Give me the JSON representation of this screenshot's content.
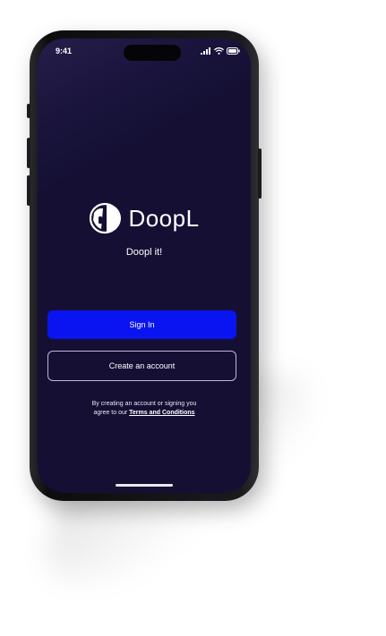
{
  "status_bar": {
    "time": "9:41",
    "icons": [
      "signal-icon",
      "wifi-icon",
      "battery-icon"
    ]
  },
  "brand": {
    "name": "DoopL",
    "tagline": "Doopl it!",
    "logo_icon": "doopl-logo-icon"
  },
  "buttons": {
    "sign_in": "Sign In",
    "create_account": "Create an account"
  },
  "legal": {
    "text_line1": "By creating an account or signing you",
    "text_line2_prefix": "agree to our",
    "link": "Terms and Conditions"
  },
  "colors": {
    "screen_bg": "#140f33",
    "primary_button": "#0a14f0",
    "outline_button_border": "#bdb9d6",
    "text": "#ffffff"
  }
}
